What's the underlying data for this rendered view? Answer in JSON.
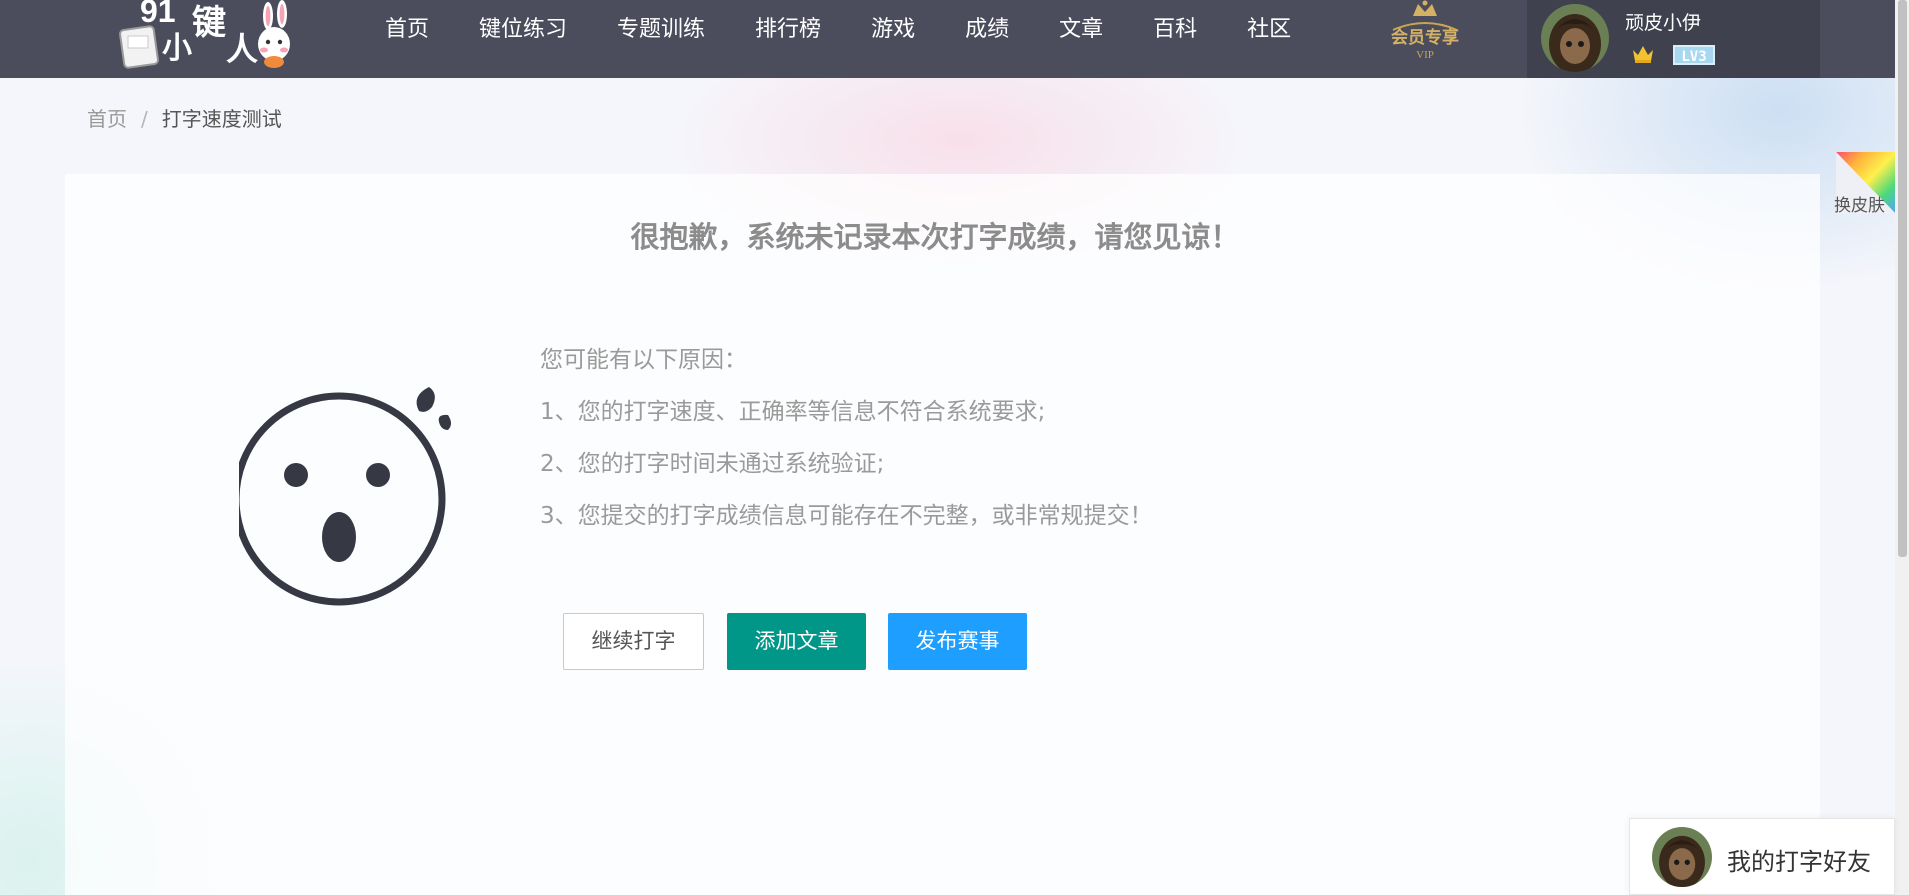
{
  "header": {
    "logo_text": "91小键人",
    "nav": [
      {
        "label": "首页"
      },
      {
        "label": "键位练习"
      },
      {
        "label": "专题训练"
      },
      {
        "label": "排行榜"
      },
      {
        "label": "游戏"
      },
      {
        "label": "成绩"
      },
      {
        "label": "文章"
      },
      {
        "label": "百科"
      },
      {
        "label": "社区"
      }
    ],
    "vip_text": "会员专享",
    "vip_sub": "VIP",
    "user": {
      "name": "顽皮小伊",
      "level": "LV3"
    }
  },
  "breadcrumb": {
    "home": "首页",
    "separator": "/",
    "current": "打字速度测试"
  },
  "main": {
    "headline": "很抱歉，系统未记录本次打字成绩，请您见谅！",
    "reasons_title": "您可能有以下原因：",
    "reasons": [
      "1、您的打字速度、正确率等信息不符合系统要求;",
      "2、您的打字时间未通过系统验证;",
      "3、您提交的打字成绩信息可能存在不完整，或非常规提交！"
    ],
    "buttons": {
      "continue": "继续打字",
      "add_article": "添加文章",
      "publish_match": "发布赛事"
    }
  },
  "skin_switch": {
    "label": "换皮肤"
  },
  "friends_widget": {
    "label": "我的打字好友"
  },
  "colors": {
    "topbar": "#4b4d5c",
    "user_panel": "#3f414f",
    "btn_add": "#009688",
    "btn_publish": "#1e9fff",
    "face_stroke": "#363944"
  }
}
